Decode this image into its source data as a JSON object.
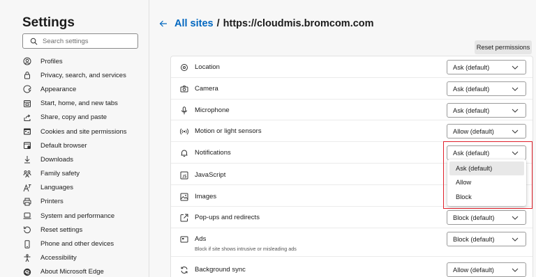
{
  "sidebar": {
    "title": "Settings",
    "search_placeholder": "Search settings",
    "items": [
      {
        "label": "Profiles",
        "icon": "profile-icon"
      },
      {
        "label": "Privacy, search, and services",
        "icon": "lock-icon"
      },
      {
        "label": "Appearance",
        "icon": "appearance-icon"
      },
      {
        "label": "Start, home, and new tabs",
        "icon": "home-tab-icon"
      },
      {
        "label": "Share, copy and paste",
        "icon": "share-icon"
      },
      {
        "label": "Cookies and site permissions",
        "icon": "cookies-icon"
      },
      {
        "label": "Default browser",
        "icon": "browser-icon"
      },
      {
        "label": "Downloads",
        "icon": "download-icon"
      },
      {
        "label": "Family safety",
        "icon": "family-icon"
      },
      {
        "label": "Languages",
        "icon": "language-icon"
      },
      {
        "label": "Printers",
        "icon": "printer-icon"
      },
      {
        "label": "System and performance",
        "icon": "laptop-icon"
      },
      {
        "label": "Reset settings",
        "icon": "reset-icon"
      },
      {
        "label": "Phone and other devices",
        "icon": "phone-icon"
      },
      {
        "label": "Accessibility",
        "icon": "accessibility-icon"
      },
      {
        "label": "About Microsoft Edge",
        "icon": "edge-icon"
      }
    ]
  },
  "header": {
    "link": "All sites",
    "separator": "/",
    "current": "https://cloudmis.bromcom.com"
  },
  "reset_label": "Reset permissions",
  "permissions": [
    {
      "label": "Location",
      "value": "Ask (default)",
      "icon": "location-icon"
    },
    {
      "label": "Camera",
      "value": "Ask (default)",
      "icon": "camera-icon"
    },
    {
      "label": "Microphone",
      "value": "Ask (default)",
      "icon": "microphone-icon"
    },
    {
      "label": "Motion or light sensors",
      "value": "Allow (default)",
      "icon": "sensor-icon"
    },
    {
      "label": "Notifications",
      "value": "Ask (default)",
      "icon": "bell-icon"
    },
    {
      "label": "JavaScript",
      "value": "",
      "icon": "javascript-icon"
    },
    {
      "label": "Images",
      "value": "",
      "icon": "image-icon"
    },
    {
      "label": "Pop-ups and redirects",
      "value": "Block (default)",
      "icon": "popup-icon"
    },
    {
      "label": "Ads",
      "sub": "Block if site shows intrusive or misleading ads",
      "value": "Block (default)",
      "icon": "ads-icon"
    },
    {
      "label": "Background sync",
      "value": "Allow (default)",
      "icon": "sync-icon"
    }
  ],
  "dropdown": {
    "options": [
      "Ask (default)",
      "Allow",
      "Block"
    ],
    "selected": "Ask (default)"
  },
  "colors": {
    "accent": "#0067c0",
    "highlight": "#e0202a"
  }
}
